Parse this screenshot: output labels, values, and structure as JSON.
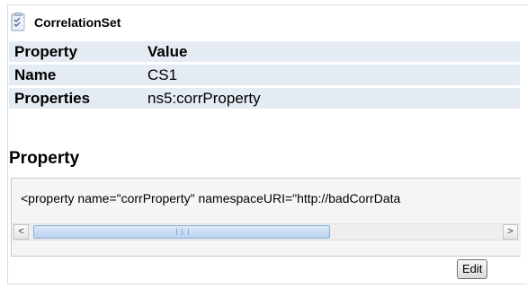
{
  "header": {
    "icon": "document-icon",
    "title": "CorrelationSet"
  },
  "table": {
    "columns": [
      "Property",
      "Value"
    ],
    "rows": [
      {
        "key": "Name",
        "value": "CS1"
      },
      {
        "key": "Properties",
        "value": "ns5:corrProperty"
      }
    ]
  },
  "section": {
    "title": "Property"
  },
  "code": {
    "text": "<property name=\"corrProperty\" namespaceURI=\"http://badCorrData"
  },
  "scrollbar": {
    "left_arrow": "<",
    "right_arrow": ">"
  },
  "actions": {
    "edit_label": "Edit"
  },
  "colors": {
    "row_background": "#e4ebf3",
    "code_background": "#f5f5f5",
    "scroll_thumb": "#c9dbf3"
  }
}
